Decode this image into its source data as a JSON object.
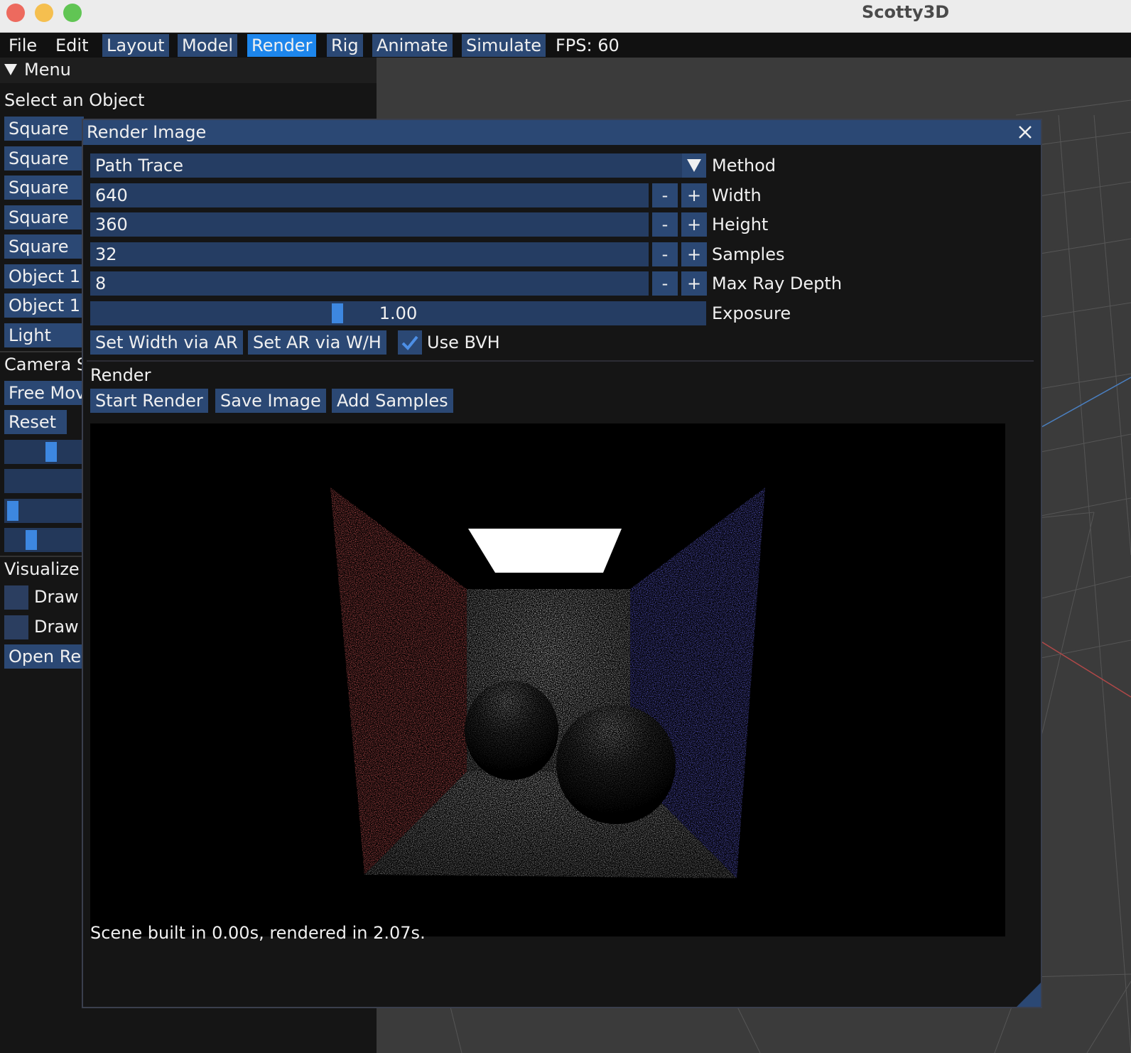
{
  "app": {
    "title": "Scotty3D"
  },
  "menubar": {
    "items": [
      {
        "label": "File"
      },
      {
        "label": "Edit"
      },
      {
        "label": "Layout"
      },
      {
        "label": "Model"
      },
      {
        "label": "Render"
      },
      {
        "label": "Rig"
      },
      {
        "label": "Animate"
      },
      {
        "label": "Simulate"
      }
    ],
    "fps": "FPS: 60"
  },
  "sidebar": {
    "menu_header": "Menu",
    "select_label": "Select an Object",
    "objects": [
      {
        "label": "Square"
      },
      {
        "label": "Square"
      },
      {
        "label": "Square"
      },
      {
        "label": "Square"
      },
      {
        "label": "Square"
      },
      {
        "label": "Object 1"
      },
      {
        "label": "Object 1"
      },
      {
        "label": "Light"
      }
    ],
    "camera_label": "Camera S",
    "free_move": "Free Mov",
    "reset": "Reset",
    "visualize_label": "Visualize",
    "draw_1": "Draw",
    "draw_2": "Draw",
    "open_render": "Open Re"
  },
  "render_window": {
    "title": "Render Image",
    "method": {
      "value": "Path Trace",
      "label": "Method"
    },
    "width": {
      "value": "640",
      "label": "Width"
    },
    "height": {
      "value": "360",
      "label": "Height"
    },
    "samples": {
      "value": "32",
      "label": "Samples"
    },
    "max_ray_depth": {
      "value": "8",
      "label": "Max Ray Depth"
    },
    "exposure": {
      "value": "1.00",
      "label": "Exposure",
      "slider_fraction": 0.4
    },
    "step_minus": "-",
    "step_plus": "+",
    "set_width_ar": "Set Width via AR",
    "set_ar_wh": "Set AR via W/H",
    "use_bvh": {
      "label": "Use BVH",
      "checked": true
    },
    "render_section": "Render",
    "start_render": "Start Render",
    "save_image": "Save Image",
    "add_samples": "Add Samples",
    "status": "Scene built in 0.00s, rendered in 2.07s."
  },
  "colors": {
    "accent": "#1d86ec",
    "button": "#2b4874",
    "left_wall": "#c84848",
    "right_wall": "#5a5ad8"
  }
}
